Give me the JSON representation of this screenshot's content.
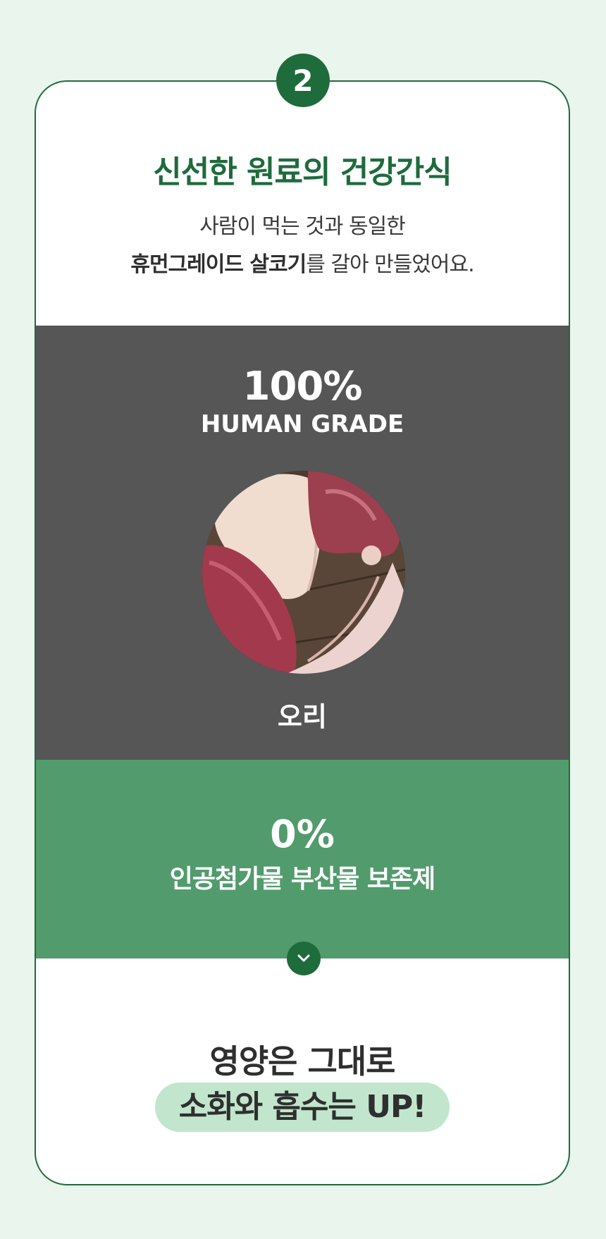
{
  "step": {
    "number": "2"
  },
  "intro": {
    "title": "신선한 원료의 건강간식",
    "line1": "사람이 먹는 것과 동일한",
    "line2_bold": "휴먼그레이드 살코기",
    "line2_rest": "를 갈아 만들었어요."
  },
  "grade": {
    "percent": "100%",
    "label": "HUMAN GRADE",
    "meat_name": "오리"
  },
  "additives": {
    "percent": "0%",
    "label": "인공첨가물 부산물 보존제"
  },
  "nutrition": {
    "line1": "영양은 그대로",
    "line2": "소화와 흡수는 UP!"
  },
  "colors": {
    "accent": "#1e6b3c",
    "green_panel": "#529b6d",
    "gray_panel": "#565656",
    "pill": "#c2e6cd",
    "background": "#eaf5ee"
  },
  "icons": {
    "chevron": "chevron-down-icon"
  }
}
